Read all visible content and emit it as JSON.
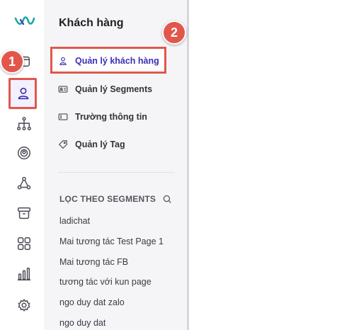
{
  "brand": {
    "logo_icon": "ladi-logo-icon",
    "accent": "#3d2fb3",
    "highlight": "#e2574c"
  },
  "rail": {
    "items": [
      {
        "icon": "box-icon"
      },
      {
        "icon": "user-icon",
        "active": true
      },
      {
        "icon": "hierarchy-icon"
      },
      {
        "icon": "broadcast-icon"
      },
      {
        "icon": "nodes-icon"
      },
      {
        "icon": "archive-icon"
      },
      {
        "icon": "apps-grid-icon"
      },
      {
        "icon": "bar-chart-icon"
      },
      {
        "icon": "gear-icon"
      }
    ]
  },
  "panel": {
    "title": "Khách hàng",
    "menu": [
      {
        "label": "Quản lý khách hàng",
        "icon": "user-icon",
        "active": true
      },
      {
        "label": "Quản lý Segments",
        "icon": "id-card-icon"
      },
      {
        "label": "Trường thông tin",
        "icon": "field-icon"
      },
      {
        "label": "Quản lý Tag",
        "icon": "tag-icon"
      }
    ],
    "segments_title": "LỌC THEO SEGMENTS",
    "segments": [
      "ladichat",
      "Mai tương tác Test Page 1",
      "Mai tương tác FB",
      "tương tác với kun page",
      "ngo duy dat zalo",
      "ngo duy dat"
    ]
  },
  "annotations": {
    "badge_1": "1",
    "badge_2": "2"
  }
}
